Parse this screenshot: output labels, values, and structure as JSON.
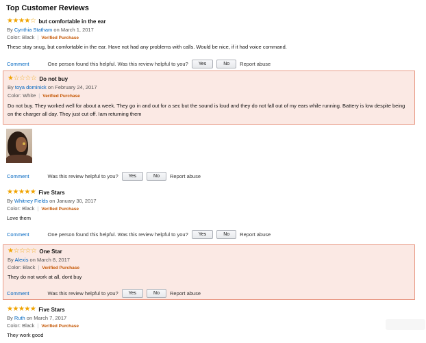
{
  "page": {
    "title": "Top Customer Reviews"
  },
  "colors": {
    "star": "#f0a300",
    "link": "#0066c0",
    "verified": "#c45500",
    "highlight_bg": "#fbe9e4",
    "highlight_border": "#e89a86"
  },
  "reviews": [
    {
      "rating": 4,
      "title": "but comfortable in the ear",
      "by": "By",
      "author": "Cynthia Statham",
      "date": "on March 1, 2017",
      "color": "Color: Black",
      "verified": "Verified Purchase",
      "body": "These stay snug, but comfortable in the ear. Have not had any problems with calls. Would be nice, if it had voice command.",
      "comment": "Comment",
      "helpful": "One person found this helpful. Was this review helpful to you?",
      "yes": "Yes",
      "no": "No",
      "report": "Report abuse"
    },
    {
      "rating": 1,
      "title": "Do not buy",
      "by": "By",
      "author": "toya dominick",
      "date": "on February 24, 2017",
      "color": "Color: White",
      "verified": "Verified Purchase",
      "body": "Do not buy. They worked well for about a week. They go in and out for a sec but the sound is loud and they do not fall out of my ears while running. Battery is low despite being on the charger all day. They just cut off. Iam returning them",
      "comment": "Comment",
      "helpful": "Was this review helpful to you?",
      "yes": "Yes",
      "no": "No",
      "report": "Report abuse"
    },
    {
      "rating": 5,
      "title": "Five Stars",
      "by": "By",
      "author": "Whitney Fields",
      "date": "on January 30, 2017",
      "color": "Color: Black",
      "verified": "Verified Purchase",
      "body": "Love them",
      "comment": "Comment",
      "helpful": "One person found this helpful. Was this review helpful to you?",
      "yes": "Yes",
      "no": "No",
      "report": "Report abuse"
    },
    {
      "rating": 1,
      "title": "One Star",
      "by": "By",
      "author": "Alexis",
      "date": "on March 8, 2017",
      "color": "Color: Black",
      "verified": "Verified Purchase",
      "body": "They do not work at all, dont buy",
      "comment": "Comment",
      "helpful": "Was this review helpful to you?",
      "yes": "Yes",
      "no": "No",
      "report": "Report abuse"
    },
    {
      "rating": 5,
      "title": "Five Stars",
      "by": "By",
      "author": "Ruth",
      "date": "on March 7, 2017",
      "color": "Color: Black",
      "verified": "Verified Purchase",
      "body": "They work good"
    }
  ]
}
